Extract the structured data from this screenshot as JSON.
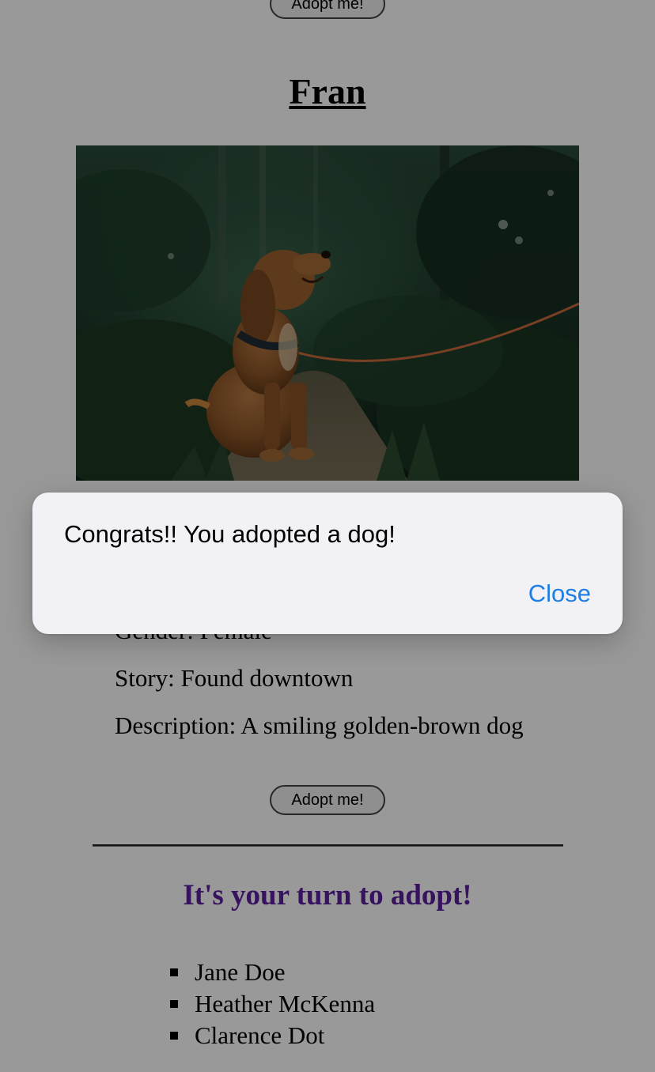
{
  "page": {
    "top_adopt_button_label": "Adopt me!",
    "dog": {
      "name": "Fran",
      "photo_alt": "Golden-brown dog on a leash sitting on a forest path",
      "gender": "Gender: Female",
      "story": "Story: Found downtown",
      "description": "Description: A smiling golden-brown dog"
    },
    "adopt_button_label": "Adopt me!",
    "turn_heading": "It's your turn to adopt!",
    "adopters": [
      "Jane Doe",
      "Heather McKenna",
      "Clarence Dot"
    ]
  },
  "dialog": {
    "message": "Congrats!! You adopted a dog!",
    "close_label": "Close"
  },
  "colors": {
    "heading_purple": "#5b1f9e",
    "dialog_background": "#f2f1f6",
    "dialog_action_blue": "#1e7ee4",
    "overlay": "rgba(0,0,0,0.4)"
  }
}
